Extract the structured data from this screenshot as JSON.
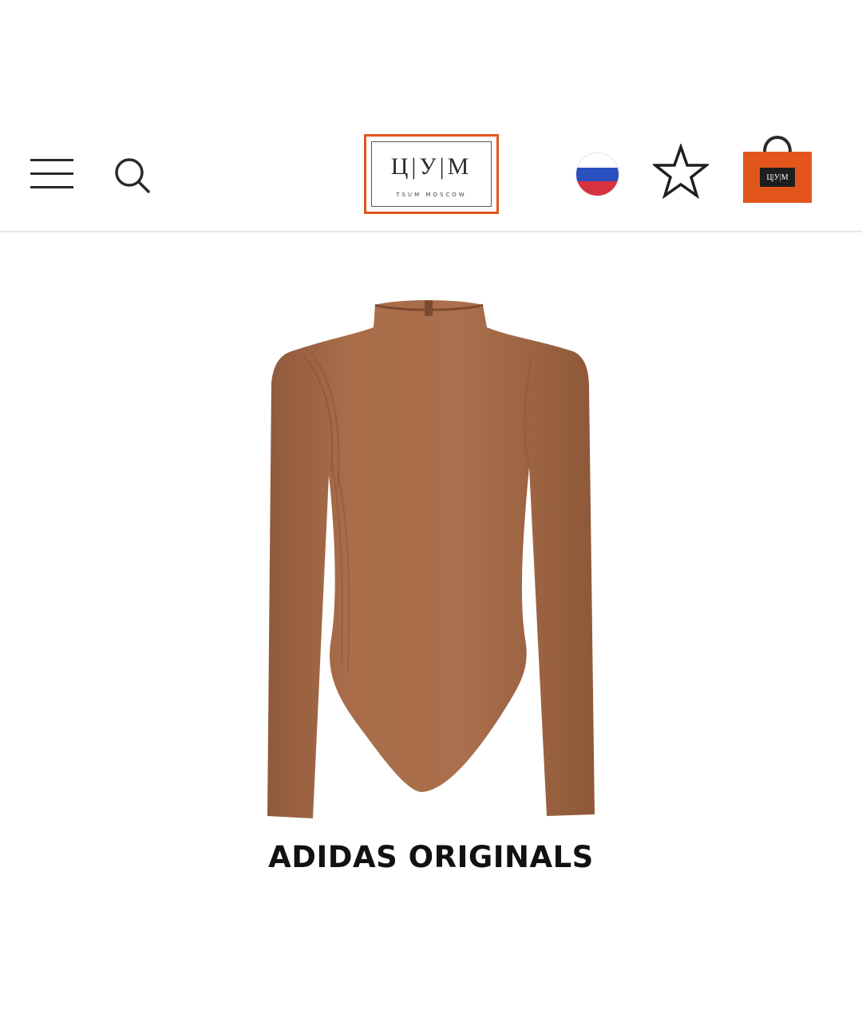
{
  "header": {
    "menu_icon": "hamburger-menu-icon",
    "search_icon": "search-icon",
    "logo": {
      "letters": "Ц|У|М",
      "subtitle": "TSUM MOSCOW",
      "accent_color": "#e2561c"
    },
    "region_flag": "russia-flag-icon",
    "favorites_icon": "star-outline-icon",
    "cart_icon": "shopping-bag-icon"
  },
  "product": {
    "image": "brown-long-sleeve-bodysuit",
    "brand": "ADIDAS ORIGINALS",
    "color": "#a66a48"
  }
}
